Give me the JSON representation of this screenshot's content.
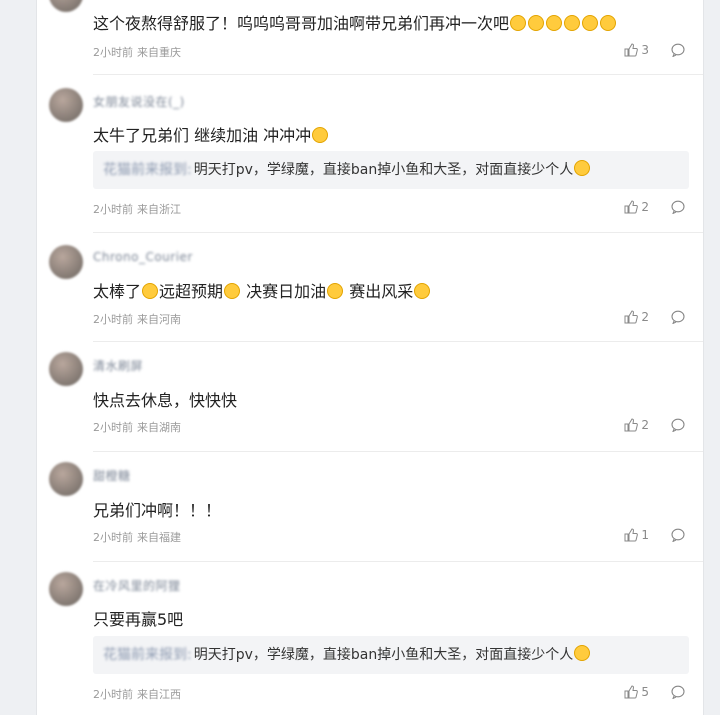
{
  "comments": [
    {
      "nick": "",
      "text": "这个夜熬得舒服了！呜呜呜哥哥加油啊带兄弟们再冲一次吧",
      "emoji_suffix": 6,
      "quote": null,
      "time": "2小时前",
      "location": "来自重庆",
      "likes": "3"
    },
    {
      "nick": "女朋友说没在(_)",
      "text": "太牛了兄弟们 继续加油 冲冲冲",
      "emoji_suffix": 1,
      "quote": {
        "name": "花猫前来报到:",
        "text": "明天打pv，学绿魔，直接ban掉小鱼和大圣，对面直接少个人"
      },
      "time": "2小时前",
      "location": "来自浙江",
      "likes": "2"
    },
    {
      "nick": "Chrono_Courier",
      "text_parts": [
        "太棒了",
        "远超预期",
        "决赛日加油",
        "赛出风采"
      ],
      "quote": null,
      "time": "2小时前",
      "location": "来自河南",
      "likes": "2"
    },
    {
      "nick": "清水刷屏",
      "text": "快点去休息，快快快",
      "emoji_suffix": 0,
      "quote": null,
      "time": "2小时前",
      "location": "来自湖南",
      "likes": "2"
    },
    {
      "nick": "甜橙糖",
      "text": "兄弟们冲啊！！！",
      "emoji_suffix": 0,
      "quote": null,
      "time": "2小时前",
      "location": "来自福建",
      "likes": "1"
    },
    {
      "nick": "在冷风里的阿狸",
      "text": "只要再赢5吧",
      "emoji_suffix": 0,
      "quote": {
        "name": "花猫前来报到:",
        "text": "明天打pv，学绿魔，直接ban掉小鱼和大圣，对面直接少个人"
      },
      "time": "2小时前",
      "location": "来自江西",
      "likes": "5"
    }
  ]
}
